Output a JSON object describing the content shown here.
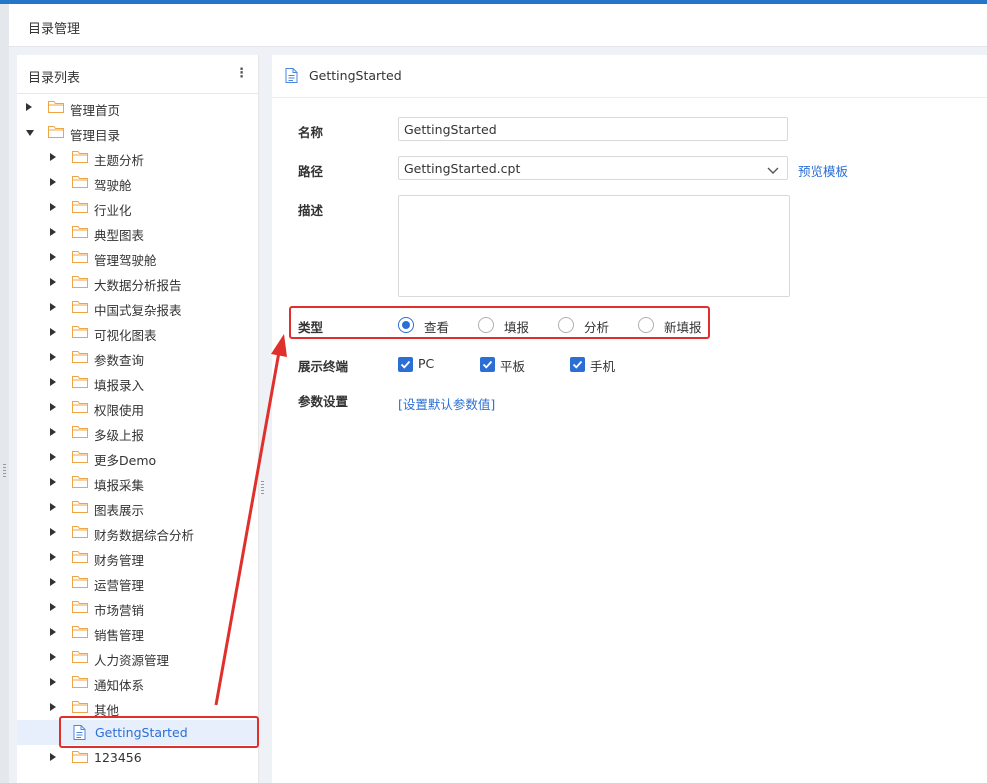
{
  "header": {
    "title": "目录管理"
  },
  "sidebar": {
    "title": "目录列表",
    "more_icon": "more-vertical-icon",
    "tree": [
      {
        "label": "管理首页",
        "level": 0,
        "expanded": false,
        "type": "folder"
      },
      {
        "label": "管理目录",
        "level": 0,
        "expanded": true,
        "type": "folder"
      },
      {
        "label": "主题分析",
        "level": 1,
        "expanded": false,
        "type": "folder"
      },
      {
        "label": "驾驶舱",
        "level": 1,
        "expanded": false,
        "type": "folder"
      },
      {
        "label": "行业化",
        "level": 1,
        "expanded": false,
        "type": "folder"
      },
      {
        "label": "典型图表",
        "level": 1,
        "expanded": false,
        "type": "folder"
      },
      {
        "label": "管理驾驶舱",
        "level": 1,
        "expanded": false,
        "type": "folder"
      },
      {
        "label": "大数据分析报告",
        "level": 1,
        "expanded": false,
        "type": "folder"
      },
      {
        "label": "中国式复杂报表",
        "level": 1,
        "expanded": false,
        "type": "folder"
      },
      {
        "label": "可视化图表",
        "level": 1,
        "expanded": false,
        "type": "folder"
      },
      {
        "label": "参数查询",
        "level": 1,
        "expanded": false,
        "type": "folder"
      },
      {
        "label": "填报录入",
        "level": 1,
        "expanded": false,
        "type": "folder"
      },
      {
        "label": "权限使用",
        "level": 1,
        "expanded": false,
        "type": "folder"
      },
      {
        "label": "多级上报",
        "level": 1,
        "expanded": false,
        "type": "folder"
      },
      {
        "label": "更多Demo",
        "level": 1,
        "expanded": false,
        "type": "folder"
      },
      {
        "label": "填报采集",
        "level": 1,
        "expanded": false,
        "type": "folder"
      },
      {
        "label": "图表展示",
        "level": 1,
        "expanded": false,
        "type": "folder"
      },
      {
        "label": "财务数据综合分析",
        "level": 1,
        "expanded": false,
        "type": "folder"
      },
      {
        "label": "财务管理",
        "level": 1,
        "expanded": false,
        "type": "folder"
      },
      {
        "label": "运营管理",
        "level": 1,
        "expanded": false,
        "type": "folder"
      },
      {
        "label": "市场营销",
        "level": 1,
        "expanded": false,
        "type": "folder"
      },
      {
        "label": "销售管理",
        "level": 1,
        "expanded": false,
        "type": "folder"
      },
      {
        "label": "人力资源管理",
        "level": 1,
        "expanded": false,
        "type": "folder"
      },
      {
        "label": "通知体系",
        "level": 1,
        "expanded": false,
        "type": "folder"
      },
      {
        "label": "其他",
        "level": 1,
        "expanded": false,
        "type": "folder"
      },
      {
        "label": "GettingStarted",
        "level": 1,
        "expanded": false,
        "type": "file",
        "selected": true
      },
      {
        "label": "123456",
        "level": 1,
        "expanded": false,
        "type": "folder"
      }
    ]
  },
  "detail": {
    "title": "GettingStarted",
    "name_label": "名称",
    "name_value": "GettingStarted",
    "path_label": "路径",
    "path_value": "GettingStarted.cpt",
    "preview_link": "预览模板",
    "desc_label": "描述",
    "desc_value": "",
    "type_label": "类型",
    "type_options": [
      "查看",
      "填报",
      "分析",
      "新填报"
    ],
    "type_selected": "查看",
    "terminal_label": "展示终端",
    "terminals": [
      {
        "label": "PC",
        "checked": true
      },
      {
        "label": "平板",
        "checked": true
      },
      {
        "label": "手机",
        "checked": true
      }
    ],
    "param_label": "参数设置",
    "param_link": "[设置默认参数值]"
  },
  "colors": {
    "accent": "#2c6fd4",
    "folder": "#f0a545",
    "highlight": "#e0302b",
    "selected_bg": "#e7effc"
  }
}
